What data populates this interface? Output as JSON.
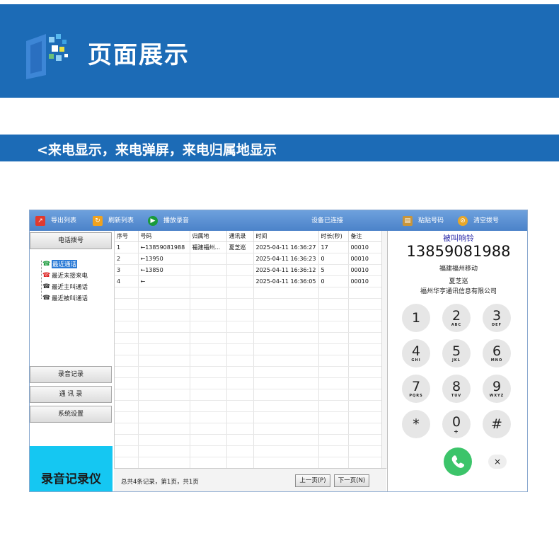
{
  "banner": {
    "title": "页面展示"
  },
  "subheader": {
    "text": "<来电显示，来电弹屏，来电归属地显示"
  },
  "toolbar": {
    "export_list": "导出列表",
    "refresh_list": "刷新列表",
    "play_recording": "播放录音",
    "device_status": "设备已连接",
    "paste_number": "粘贴号码",
    "clear_dial": "清空拨号"
  },
  "leftnav": {
    "phone_dial": "电话拨号",
    "tree": [
      {
        "label": "最近通话",
        "icon": "phone-recent-icon"
      },
      {
        "label": "最近未接来电",
        "icon": "missed-call-icon"
      },
      {
        "label": "最近主叫通话",
        "icon": "outgoing-call-icon"
      },
      {
        "label": "最近被叫通话",
        "icon": "incoming-call-icon"
      }
    ],
    "recordings": "录音记录",
    "contacts": "通 讯 录",
    "settings": "系统设置",
    "brand": "录音记录仪"
  },
  "table": {
    "headers": [
      "序号",
      "号码",
      "归属地",
      "通讯录",
      "时间",
      "时长(秒)",
      "备注"
    ],
    "rows": [
      [
        "1",
        "←13859081988",
        "福建福州...",
        "夏芝巡",
        "2025-04-11 16:36:27",
        "17",
        "00010"
      ],
      [
        "2",
        "←13950",
        "",
        "",
        "2025-04-11 16:36:23",
        "0",
        "00010"
      ],
      [
        "3",
        "←13850",
        "",
        "",
        "2025-04-11 16:36:12",
        "5",
        "00010"
      ],
      [
        "4",
        "←",
        "",
        "",
        "2025-04-11 16:36:05",
        "0",
        "00010"
      ]
    ],
    "summary": "总共4条记录，第1页，共1页",
    "prev_page": "上一页(P)",
    "next_page": "下一页(N)"
  },
  "dialer": {
    "status": "被叫响铃",
    "number": "13859081988",
    "location": "福建福州移动",
    "contact_name": "夏芝巡",
    "company": "福州华亨通讯信息有限公司",
    "keys": [
      {
        "digit": "1",
        "letters": ""
      },
      {
        "digit": "2",
        "letters": "ABC"
      },
      {
        "digit": "3",
        "letters": "DEF"
      },
      {
        "digit": "4",
        "letters": "GHI"
      },
      {
        "digit": "5",
        "letters": "JKL"
      },
      {
        "digit": "6",
        "letters": "MNO"
      },
      {
        "digit": "7",
        "letters": "PQRS"
      },
      {
        "digit": "8",
        "letters": "TUV"
      },
      {
        "digit": "9",
        "letters": "WXYZ"
      },
      {
        "digit": "*",
        "letters": ""
      },
      {
        "digit": "0",
        "letters": "+"
      },
      {
        "digit": "#",
        "letters": ""
      }
    ],
    "backspace": "×"
  }
}
